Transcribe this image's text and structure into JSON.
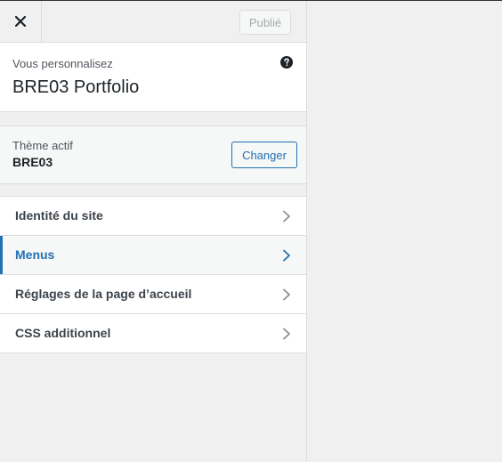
{
  "header": {
    "close_icon": "close-icon",
    "publish_label": "Publié"
  },
  "info": {
    "subtitle": "Vous personnalisez",
    "site_title": "BRE03 Portfolio",
    "help_icon": "help-icon"
  },
  "theme": {
    "label": "Thème actif",
    "name": "BRE03",
    "change_label": "Changer"
  },
  "sections": [
    {
      "label": "Identité du site",
      "active": false
    },
    {
      "label": "Menus",
      "active": true
    },
    {
      "label": "Réglages de la page d’accueil",
      "active": false
    },
    {
      "label": "CSS additionnel",
      "active": false
    }
  ],
  "colors": {
    "accent": "#2271b1",
    "panel_bg": "#f0f0f1",
    "text": "#1d2327"
  }
}
